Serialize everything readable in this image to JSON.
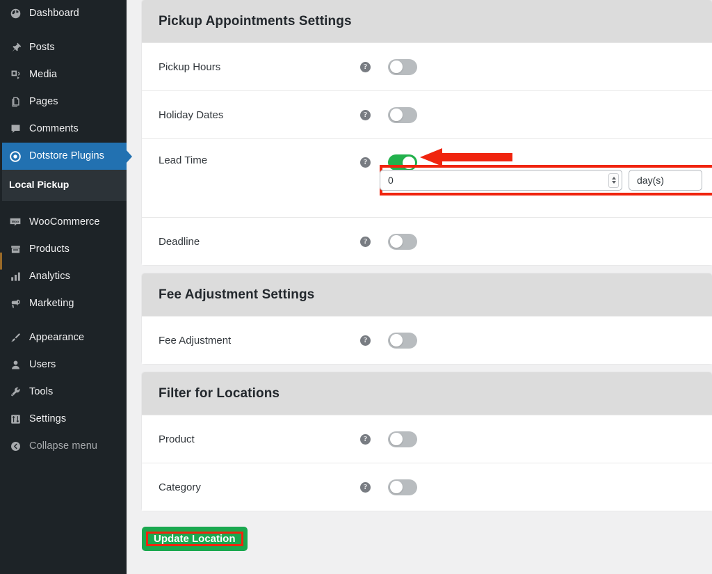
{
  "sidebar": {
    "items": [
      {
        "label": "Dashboard",
        "icon": "dashboard-icon",
        "current": false,
        "dim": false,
        "spacer": false
      },
      {
        "label": "Posts",
        "icon": "pin-icon",
        "current": false,
        "dim": false,
        "spacer": true
      },
      {
        "label": "Media",
        "icon": "media-icon",
        "current": false,
        "dim": false,
        "spacer": false
      },
      {
        "label": "Pages",
        "icon": "pages-icon",
        "current": false,
        "dim": false,
        "spacer": false
      },
      {
        "label": "Comments",
        "icon": "comments-icon",
        "current": false,
        "dim": false,
        "spacer": false
      },
      {
        "label": "Dotstore Plugins",
        "icon": "dotstore-target-icon",
        "current": true,
        "dim": false,
        "spacer": false
      }
    ],
    "submenu": [
      {
        "label": "Local Pickup"
      }
    ],
    "items_lower": [
      {
        "label": "WooCommerce",
        "icon": "woocommerce-icon",
        "current": false,
        "dim": false,
        "spacer": false
      },
      {
        "label": "Products",
        "icon": "products-box-icon",
        "current": false,
        "dim": false,
        "spacer": false
      },
      {
        "label": "Analytics",
        "icon": "analytics-bars-icon",
        "current": false,
        "dim": false,
        "spacer": false
      },
      {
        "label": "Marketing",
        "icon": "megaphone-icon",
        "current": false,
        "dim": false,
        "spacer": false
      },
      {
        "label": "Appearance",
        "icon": "paintbrush-icon",
        "current": false,
        "dim": false,
        "spacer": true
      },
      {
        "label": "Users",
        "icon": "user-icon",
        "current": false,
        "dim": false,
        "spacer": false
      },
      {
        "label": "Tools",
        "icon": "wrench-icon",
        "current": false,
        "dim": false,
        "spacer": false
      },
      {
        "label": "Settings",
        "icon": "settings-sliders-icon",
        "current": false,
        "dim": false,
        "spacer": false
      },
      {
        "label": "Collapse menu",
        "icon": "collapse-arrow-icon",
        "current": false,
        "dim": true,
        "spacer": false
      }
    ]
  },
  "sections": [
    {
      "title": "Pickup Appointments Settings",
      "rows": [
        {
          "label": "Pickup Hours",
          "help": "?",
          "toggle_on": false
        },
        {
          "label": "Holiday Dates",
          "help": "?",
          "toggle_on": false
        },
        {
          "label": "Lead Time",
          "help": "?",
          "toggle_on": true,
          "has_subrow": true
        },
        {
          "label": "Deadline",
          "help": "?",
          "toggle_on": false
        }
      ]
    },
    {
      "title": "Fee Adjustment Settings",
      "rows": [
        {
          "label": "Fee Adjustment",
          "help": "?",
          "toggle_on": false
        }
      ]
    },
    {
      "title": "Filter for Locations",
      "rows": [
        {
          "label": "Product",
          "help": "?",
          "toggle_on": false
        },
        {
          "label": "Category",
          "help": "?",
          "toggle_on": false
        }
      ]
    }
  ],
  "lead_time": {
    "value": "0",
    "placeholder": "0",
    "unit": "day(s)",
    "unit_placeholder": "day(s)"
  },
  "footer": {
    "update_button": "Update Location"
  },
  "colors": {
    "sidebar_bg": "#1d2327",
    "sidebar_current": "#2271b1",
    "submenu_bg": "#2c3338",
    "page_bg": "#f0f0f1",
    "section_header_bg": "#dcdcdc",
    "toggle_on": "#22b14c",
    "toggle_off": "#b8bcbf",
    "highlight_red": "#f0240e",
    "button_green": "#1aa84f"
  }
}
